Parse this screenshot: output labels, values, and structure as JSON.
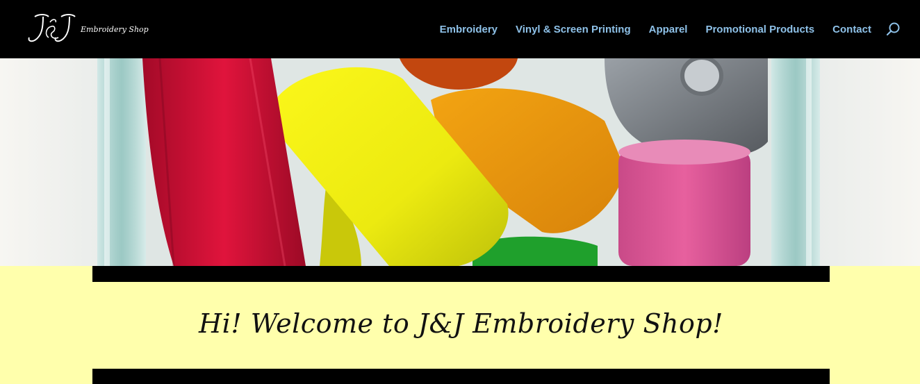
{
  "brand": {
    "logo_initials": "J&J",
    "logo_text": "Embroidery Shop"
  },
  "nav": {
    "items": [
      {
        "label": "Embroidery"
      },
      {
        "label": "Vinyl & Screen Printing"
      },
      {
        "label": "Apparel"
      },
      {
        "label": "Promotional Products"
      },
      {
        "label": "Contact"
      }
    ],
    "search_icon": "search-icon"
  },
  "hero": {
    "image": "colorful-thread-spools-in-glass-jar"
  },
  "content": {
    "welcome_heading": "Hi! Welcome to J&J Embroidery Shop!"
  },
  "colors": {
    "header_bg": "#000000",
    "nav_link": "#8ec1e8",
    "page_bg": "#ffffac",
    "bar": "#000000"
  }
}
